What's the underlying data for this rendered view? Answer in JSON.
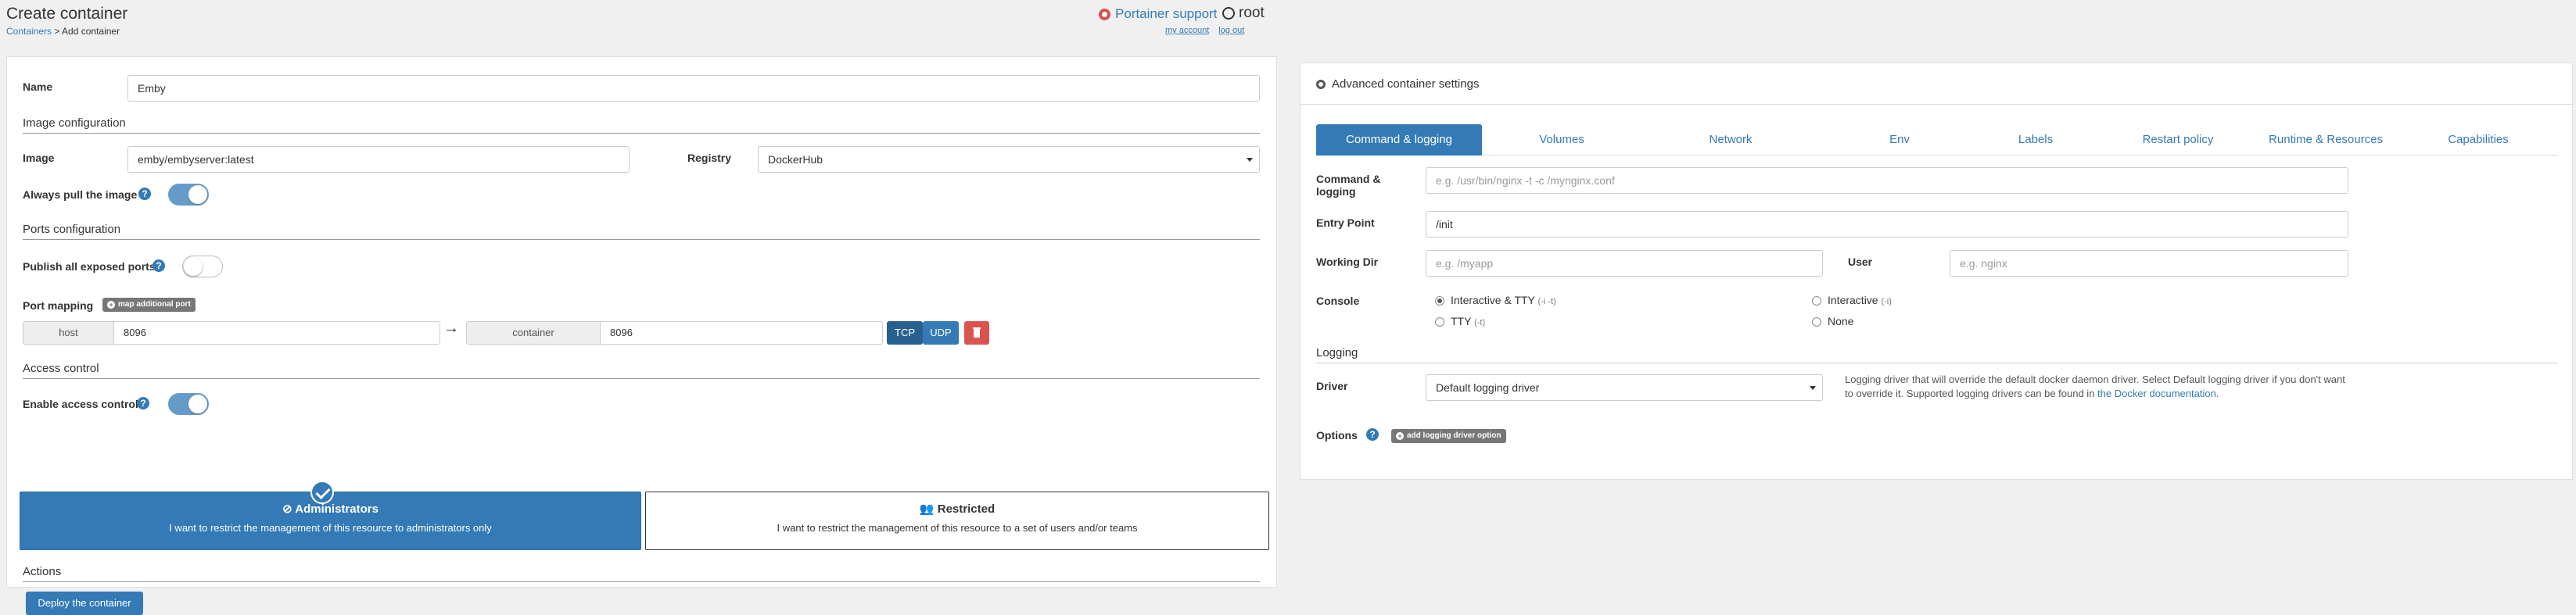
{
  "header": {
    "title": "Create container",
    "breadcrumb_link": "Containers",
    "breadcrumb_sep": " > ",
    "breadcrumb_current": "Add container",
    "support": "Portainer support",
    "user": "root",
    "my_account": "my account",
    "log_out": "log out"
  },
  "form": {
    "name_label": "Name",
    "name_value": "Emby",
    "image_section": "Image configuration",
    "image_label": "Image",
    "image_value": "emby/embyserver:latest",
    "registry_label": "Registry",
    "registry_value": "DockerHub",
    "always_pull_label": "Always pull the image",
    "always_pull": true,
    "ports_section": "Ports configuration",
    "publish_all_label": "Publish all exposed ports",
    "publish_all": false,
    "port_mapping_label": "Port mapping",
    "map_port_button": "map additional port",
    "host_addon": "host",
    "host_port": "8096",
    "container_addon": "container",
    "container_port": "8096",
    "arrow": "→",
    "tcp": "TCP",
    "udp": "UDP",
    "access_section": "Access control",
    "enable_access_label": "Enable access control",
    "enable_access": true,
    "admin_title": "Administrators",
    "admin_desc": "I want to restrict the management of this resource to administrators only",
    "restricted_title": "Restricted",
    "restricted_desc": "I want to restrict the management of this resource to a set of users and/or teams",
    "actions_section": "Actions",
    "deploy_button": "Deploy the container"
  },
  "advanced": {
    "title": "Advanced container settings",
    "tabs": [
      {
        "label": "Command & logging"
      },
      {
        "label": "Volumes"
      },
      {
        "label": "Network"
      },
      {
        "label": "Env"
      },
      {
        "label": "Labels"
      },
      {
        "label": "Restart policy"
      },
      {
        "label": "Runtime & Resources"
      },
      {
        "label": "Capabilities"
      }
    ],
    "command_label_1": "Command &",
    "command_label_2": "logging",
    "command_placeholder": "e.g. /usr/bin/nginx -t -c /mynginx.conf",
    "entrypoint_label": "Entry Point",
    "entrypoint_value": "/init",
    "workdir_label": "Working Dir",
    "workdir_placeholder": "e.g. /myapp",
    "user_label": "User",
    "user_placeholder": "e.g. nginx",
    "console_label": "Console",
    "console_options": [
      {
        "label": "Interactive & TTY",
        "hint": "(-i -t)",
        "selected": true
      },
      {
        "label": "Interactive",
        "hint": "(-i)",
        "selected": false
      },
      {
        "label": "TTY",
        "hint": "(-t)",
        "selected": false
      },
      {
        "label": "None",
        "hint": "",
        "selected": false
      }
    ],
    "logging_section": "Logging",
    "driver_label": "Driver",
    "driver_value": "Default logging driver",
    "driver_note": "Logging driver that will override the default docker daemon driver. Select Default logging driver if you don't want to override it. Supported logging drivers can be found in ",
    "driver_note_link": "the Docker documentation",
    "driver_note_end": ".",
    "options_label": "Options",
    "add_option_button": "add logging driver option"
  },
  "colors": {
    "primary": "#337ab7",
    "danger": "#d9534f",
    "muted_badge": "#777777"
  }
}
